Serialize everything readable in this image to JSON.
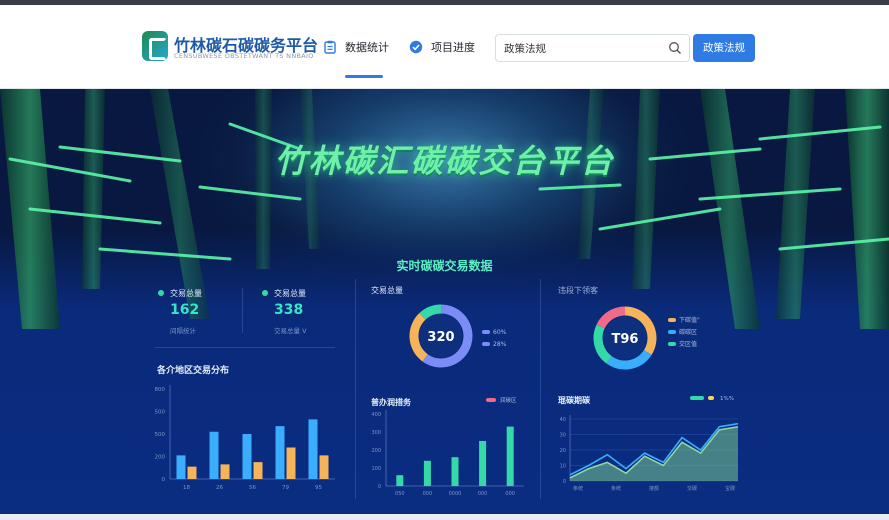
{
  "header": {
    "logo_title": "竹林碳石碳碳务平台",
    "logo_subtitle": "CENSUBWESE OBSTETWANT TS NNBAIO",
    "nav": [
      {
        "label": "数据统计",
        "icon": "clipboard-icon",
        "active": true
      },
      {
        "label": "项目进度",
        "icon": "check-badge-icon",
        "active": false
      }
    ],
    "search_value": "政策法规",
    "search_button": "政策法规",
    "accent": "#2f7be4"
  },
  "hero": {
    "title": "竹林碳汇碳碳交台平台",
    "section_title": "实时碳碳交易数据"
  },
  "summary": {
    "item1_label": "交易总量",
    "item1_value": "162",
    "item1_sub": "间隔统计",
    "item2_label": "交易总量",
    "item2_value": "338",
    "item2_sub": "交易总量 V"
  },
  "chart_data": [
    {
      "type": "bar",
      "title": "各介地区交易分布",
      "categories": [
        "18",
        "26",
        "56",
        "79",
        "95"
      ],
      "ylim": [
        0,
        800
      ],
      "yticks": [
        "0",
        "200",
        "500",
        "500",
        "800"
      ],
      "series": [
        {
          "values": [
            210,
            420,
            400,
            470,
            530
          ],
          "color": "#3aaefc"
        },
        {
          "values": [
            110,
            130,
            150,
            280,
            210
          ],
          "color": "#f5b45a"
        }
      ]
    },
    {
      "type": "pie",
      "title": "交易总量",
      "center_label": "320",
      "legend": [
        "60%",
        "28%"
      ],
      "values": [
        60,
        28,
        12
      ],
      "colors": [
        "#7b8cf7",
        "#f5b45a",
        "#35d9a8"
      ]
    },
    {
      "type": "pie",
      "title": "违段下领客",
      "center_label": "T96",
      "legend": [
        "下碳值\"",
        "碳碳区",
        "交区值"
      ],
      "values": [
        34,
        26,
        22,
        18
      ],
      "colors": [
        "#f5b45a",
        "#3aaefc",
        "#35d9a8",
        "#f06b8a"
      ]
    },
    {
      "type": "bar",
      "title": "普办润措务",
      "legend": [
        "润碳区"
      ],
      "categories": [
        "050",
        "000",
        "0000",
        "000",
        "000"
      ],
      "ylim": [
        0,
        400
      ],
      "yticks": [
        "0",
        "100",
        "200",
        "300",
        "400"
      ],
      "values": [
        60,
        140,
        160,
        250,
        330
      ],
      "color": "#35d9a8"
    },
    {
      "type": "area",
      "title": "琨碳期碳",
      "legend": [
        "",
        "1%%"
      ],
      "categories": [
        "条统",
        "条统",
        "接额",
        "交碳",
        "宝碳"
      ],
      "ylim": [
        0,
        40
      ],
      "yticks": [
        "0",
        "10",
        "20",
        "30",
        "40"
      ],
      "series": [
        {
          "values": [
            4,
            10,
            17,
            8,
            18,
            12,
            28,
            20,
            35,
            37
          ],
          "color": "#3aaefc"
        },
        {
          "values": [
            2,
            8,
            12,
            5,
            16,
            10,
            25,
            18,
            33,
            35
          ],
          "color": "#8fd6a0"
        }
      ]
    }
  ]
}
